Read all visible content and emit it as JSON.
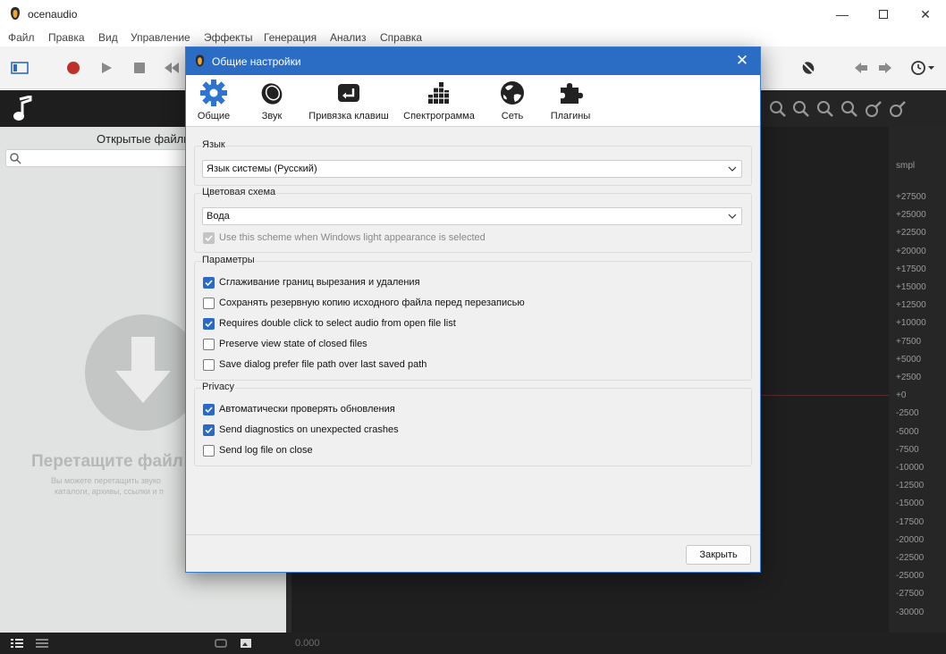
{
  "app": {
    "title": "ocenaudio",
    "menu": [
      "Файл",
      "Правка",
      "Вид",
      "Управление",
      "Эффекты",
      "Генерация",
      "Анализ",
      "Справка"
    ]
  },
  "left_panel": {
    "header": "Открытые файлы",
    "drop_title": "Перетащите файл",
    "drop_hint_line1": "Вы можете перетащить звуко",
    "drop_hint_line2": "каталоги, архивы, ссылки и п"
  },
  "editor": {
    "scale_unit": "smpl",
    "scale_ticks": [
      "+27500",
      "+25000",
      "+22500",
      "+20000",
      "+17500",
      "+15000",
      "+12500",
      "+10000",
      "+7500",
      "+5000",
      "+2500",
      "+0",
      "-2500",
      "-5000",
      "-7500",
      "-10000",
      "-12500",
      "-15000",
      "-17500",
      "-20000",
      "-22500",
      "-25000",
      "-27500",
      "-30000"
    ],
    "time": "0.000"
  },
  "dialog": {
    "title": "Общие настройки",
    "tabs": [
      {
        "label": "Общие",
        "icon": "gear-icon"
      },
      {
        "label": "Звук",
        "icon": "speaker-icon"
      },
      {
        "label": "Привязка клавиш",
        "icon": "keyboard-icon"
      },
      {
        "label": "Спектрограмма",
        "icon": "spectrogram-icon"
      },
      {
        "label": "Сеть",
        "icon": "globe-icon"
      },
      {
        "label": "Плагины",
        "icon": "puzzle-icon"
      }
    ],
    "language": {
      "label": "Язык",
      "value": "Язык системы (Русский)"
    },
    "color_scheme": {
      "label": "Цветовая схема",
      "value": "Вода",
      "light_option": {
        "label": "Use this scheme when Windows light appearance is selected",
        "checked": true,
        "disabled": true
      }
    },
    "params": {
      "label": "Параметры",
      "items": [
        {
          "label": "Сглаживание границ вырезания и удаления",
          "checked": true
        },
        {
          "label": "Сохранять резервную копию исходного файла перед перезаписью",
          "checked": false
        },
        {
          "label": "Requires double click to select audio from open file list",
          "checked": true
        },
        {
          "label": "Preserve view state of closed files",
          "checked": false
        },
        {
          "label": "Save dialog prefer file path over last saved path",
          "checked": false
        }
      ]
    },
    "privacy": {
      "label": "Privacy",
      "items": [
        {
          "label": "Автоматически проверять обновления",
          "checked": true
        },
        {
          "label": "Send diagnostics on unexpected crashes",
          "checked": true
        },
        {
          "label": "Send log file on close",
          "checked": false
        }
      ]
    },
    "close_button": "Закрыть"
  },
  "colors": {
    "accent": "#2969c7",
    "title_bar": "#2b6cc4",
    "record": "#c0302a"
  }
}
